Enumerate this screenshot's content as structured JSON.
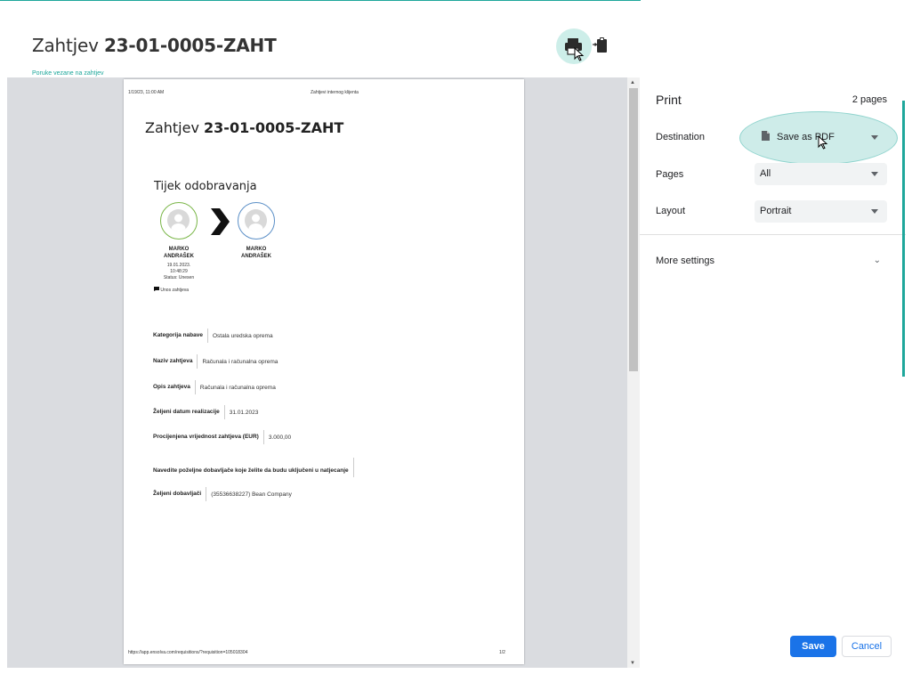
{
  "header": {
    "title_prefix": "Zahtjev ",
    "title_code": "23-01-0005-ZAHT",
    "sub_link": "Poruke vezane na zahtjev"
  },
  "preview": {
    "header_date": "1/19/23, 11:00 AM",
    "header_doc": "Zahtjevi internog klijenta",
    "title_prefix": "Zahtjev ",
    "title_code": "23-01-0005-ZAHT",
    "section_title": "Tijek odobravanja",
    "person1": {
      "name_line1": "MARKO",
      "name_line2": "ANDRAŠEK",
      "date": "19.01.2023.",
      "time": "10:48:29",
      "status": "Status: Unesen",
      "comment": "Unos zahtjeva"
    },
    "person2": {
      "name_line1": "MARKO",
      "name_line2": "ANDRAŠEK"
    },
    "fields": [
      {
        "label": "Kategorija nabave",
        "value": "Ostala uredska oprema"
      },
      {
        "label": "Naziv zahtjeva",
        "value": "Računala i računalna oprema"
      },
      {
        "label": "Opis zahtjeva",
        "value": "Računala i računalna oprema"
      },
      {
        "label": "Željeni datum realizacije",
        "value": "31.01.2023"
      },
      {
        "label": "Procijenjena vrijednost zahtjeva (EUR)",
        "value": "3.000,00"
      },
      {
        "label": "Navedite poželjne dobavljače koje želite da budu uključeni u natjecanje",
        "value": ""
      },
      {
        "label": "Željeni dobavljači",
        "value": "(35536638227) Bean Company"
      }
    ],
    "footer_url": "https://app.ensolva.com/requisitions/?requisition=105018304",
    "footer_page": "1/2"
  },
  "print_panel": {
    "title": "Print",
    "page_count": "2 pages",
    "destination_label": "Destination",
    "destination_value": "Save as PDF",
    "pages_label": "Pages",
    "pages_value": "All",
    "layout_label": "Layout",
    "layout_value": "Portrait",
    "more_settings": "More settings",
    "save": "Save",
    "cancel": "Cancel"
  },
  "colors": {
    "accent": "#1ea79b",
    "primary_button": "#1a73e8"
  },
  "icons": {
    "print": "printer-icon",
    "clipboard": "clipboard-icon",
    "pdf": "file-icon"
  }
}
